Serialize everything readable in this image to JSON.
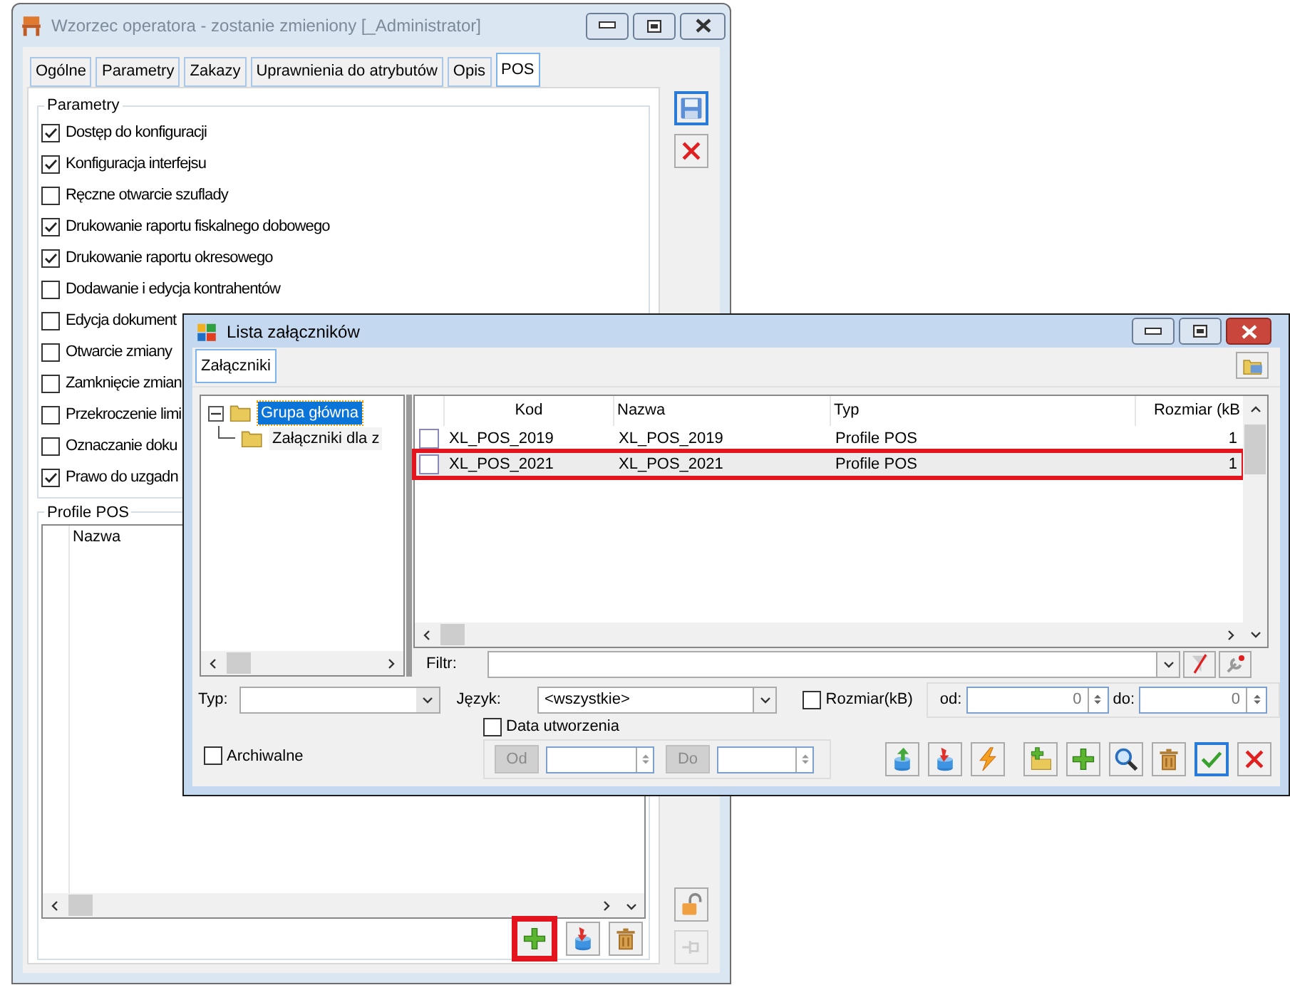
{
  "main_window": {
    "title": "Wzorzec operatora - zostanie zmieniony [_Administrator]",
    "tabs": [
      {
        "label": "Ogólne",
        "selected": false
      },
      {
        "label": "Parametry",
        "selected": false
      },
      {
        "label": "Zakazy",
        "selected": false
      },
      {
        "label": "Uprawnienia do atrybutów",
        "selected": false
      },
      {
        "label": "Opis",
        "selected": false
      },
      {
        "label": "POS",
        "selected": true
      }
    ],
    "parameters_group": {
      "title": "Parametry",
      "options": [
        {
          "label": "Dostęp do konfiguracji",
          "checked": true
        },
        {
          "label": "Konfiguracja interfejsu",
          "checked": true
        },
        {
          "label": "Ręczne otwarcie szuflady",
          "checked": false
        },
        {
          "label": "Drukowanie raportu fiskalnego dobowego",
          "checked": true
        },
        {
          "label": "Drukowanie raportu okresowego",
          "checked": true
        },
        {
          "label": "Dodawanie i edycja kontrahentów",
          "checked": false
        },
        {
          "label": "Edycja dokument",
          "checked": false
        },
        {
          "label": "Otwarcie zmiany",
          "checked": false
        },
        {
          "label": "Zamknięcie zmian",
          "checked": false
        },
        {
          "label": "Przekroczenie limi",
          "checked": false
        },
        {
          "label": "Oznaczanie doku",
          "checked": false
        },
        {
          "label": "Prawo do uzgadn",
          "checked": true
        }
      ]
    },
    "profiles_group": {
      "title": "Profile POS",
      "columns": [
        "Nazwa"
      ],
      "buttons": [
        {
          "kind": "add",
          "highlighted": true
        },
        {
          "kind": "import",
          "highlighted": false
        },
        {
          "kind": "delete",
          "highlighted": false
        }
      ]
    },
    "side_buttons": [
      {
        "kind": "save",
        "disabled": false
      },
      {
        "kind": "cancel",
        "disabled": false
      },
      {
        "kind": "lock",
        "disabled": false
      },
      {
        "kind": "pin",
        "disabled": true
      }
    ]
  },
  "attachments_window": {
    "title": "Lista załączników",
    "tabs": [
      {
        "label": "Załączniki",
        "selected": true
      }
    ],
    "tree": [
      {
        "label": "Grupa główna",
        "selected": true,
        "expanded": true,
        "children": [
          {
            "label": "Załączniki dla z",
            "selected": false
          }
        ]
      }
    ],
    "table": {
      "columns": [
        "Kod",
        "Nazwa",
        "Typ",
        "Rozmiar (kB"
      ],
      "rows": [
        {
          "checked": false,
          "selected": false,
          "highlighted": false,
          "cells": [
            "XL_POS_2019",
            "XL_POS_2019",
            "Profile POS",
            "1"
          ]
        },
        {
          "checked": false,
          "selected": true,
          "highlighted": true,
          "cells": [
            "XL_POS_2021",
            "XL_POS_2021",
            "Profile POS",
            "1"
          ]
        }
      ]
    },
    "filter": {
      "label": "Filtr:"
    },
    "type": {
      "label": "Typ:"
    },
    "language": {
      "label": "Język:",
      "value": "<wszystkie>"
    },
    "size": {
      "label": "Rozmiar(kB)",
      "checked": false,
      "from_label": "od:",
      "from": "0",
      "to_label": "do:",
      "to": "0"
    },
    "created": {
      "label": "Data utworzenia",
      "checked": false,
      "from_button": "Od",
      "to_button": "Do"
    },
    "archive": {
      "label": "Archiwalne",
      "checked": false
    },
    "buttons": [
      {
        "kind": "export",
        "focused": false
      },
      {
        "kind": "import",
        "focused": false
      },
      {
        "kind": "lightning",
        "focused": false
      },
      {
        "kind": "add_folder",
        "focused": false
      },
      {
        "kind": "add",
        "focused": false
      },
      {
        "kind": "search",
        "focused": false
      },
      {
        "kind": "delete",
        "focused": false
      },
      {
        "kind": "ok",
        "focused": true
      },
      {
        "kind": "cancel",
        "focused": false
      }
    ]
  }
}
